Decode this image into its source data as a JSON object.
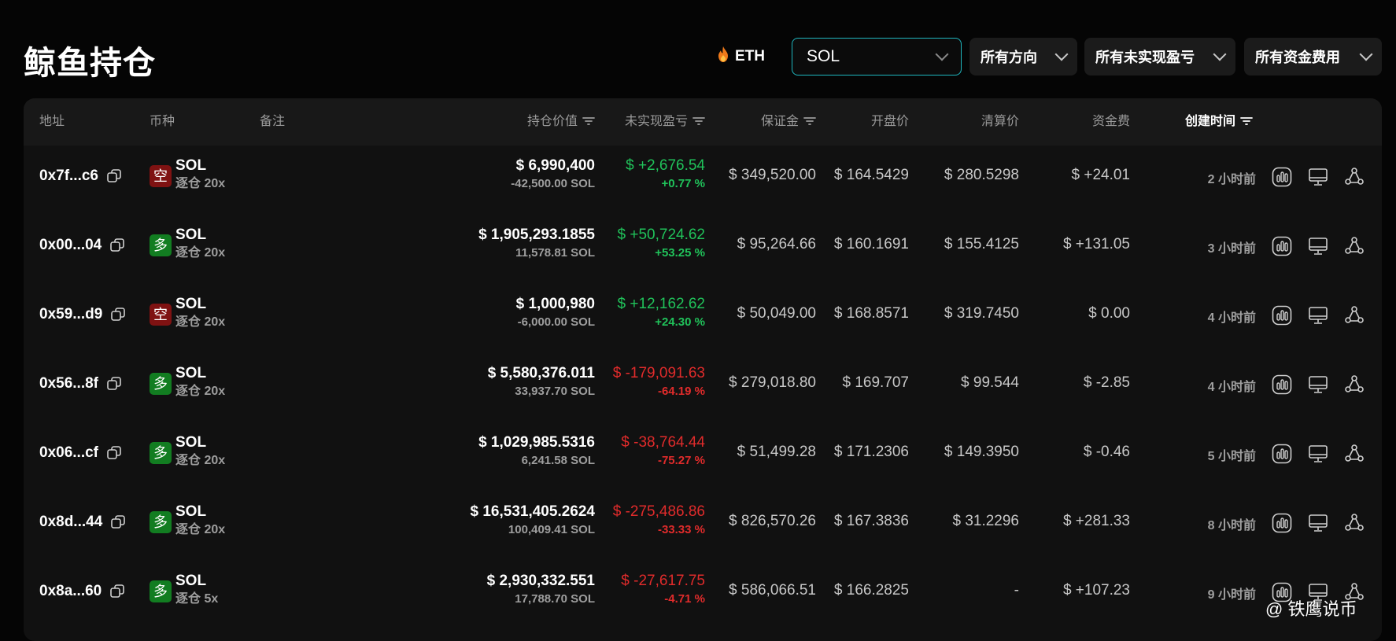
{
  "title": "鲸鱼持仓",
  "filters": {
    "eth_label": "ETH",
    "eth_icon": "fire-icon",
    "coin_select": "SOL",
    "direction_select": "所有方向",
    "pnl_select": "所有未实现盈亏",
    "funding_select": "所有资金费用"
  },
  "columns": {
    "address": "地址",
    "coin": "币种",
    "note": "备注",
    "value": "持仓价值",
    "pnl": "未实现盈亏",
    "margin": "保证金",
    "entry": "开盘价",
    "liq": "清算价",
    "funding": "资金费",
    "created": "创建时间"
  },
  "colors": {
    "positive": "#20c25a",
    "negative": "#e02b2b",
    "short_badge": "#7f1212",
    "long_badge": "#127d21",
    "accent_border": "#1fb7bf"
  },
  "rows": [
    {
      "address": "0x7f...c6",
      "side": "空",
      "side_type": "short",
      "coin": "SOL",
      "leverage": "逐仓 20x",
      "value": "$ 6,990,400",
      "amount": "-42,500.00 SOL",
      "pnl": "$ +2,676.54",
      "pnl_pct": "+0.77 %",
      "pnl_sign": "pos",
      "margin": "$ 349,520.00",
      "entry": "$ 164.5429",
      "liq": "$ 280.5298",
      "funding": "$ +24.01",
      "funding_sign": "pos",
      "created": "2 小时前"
    },
    {
      "address": "0x00...04",
      "side": "多",
      "side_type": "long",
      "coin": "SOL",
      "leverage": "逐仓 20x",
      "value": "$ 1,905,293.1855",
      "amount": "11,578.81 SOL",
      "pnl": "$ +50,724.62",
      "pnl_pct": "+53.25 %",
      "pnl_sign": "pos",
      "margin": "$ 95,264.66",
      "entry": "$ 160.1691",
      "liq": "$ 155.4125",
      "funding": "$ +131.05",
      "funding_sign": "pos",
      "created": "3 小时前"
    },
    {
      "address": "0x59...d9",
      "side": "空",
      "side_type": "short",
      "coin": "SOL",
      "leverage": "逐仓 20x",
      "value": "$ 1,000,980",
      "amount": "-6,000.00 SOL",
      "pnl": "$ +12,162.62",
      "pnl_pct": "+24.30 %",
      "pnl_sign": "pos",
      "margin": "$ 50,049.00",
      "entry": "$ 168.8571",
      "liq": "$ 319.7450",
      "funding": "$ 0.00",
      "funding_sign": "neutral",
      "created": "4 小时前"
    },
    {
      "address": "0x56...8f",
      "side": "多",
      "side_type": "long",
      "coin": "SOL",
      "leverage": "逐仓 20x",
      "value": "$ 5,580,376.011",
      "amount": "33,937.70 SOL",
      "pnl": "$ -179,091.63",
      "pnl_pct": "-64.19 %",
      "pnl_sign": "neg",
      "margin": "$ 279,018.80",
      "entry": "$ 169.707",
      "liq": "$ 99.544",
      "funding": "$ -2.85",
      "funding_sign": "neg",
      "created": "4 小时前"
    },
    {
      "address": "0x06...cf",
      "side": "多",
      "side_type": "long",
      "coin": "SOL",
      "leverage": "逐仓 20x",
      "value": "$ 1,029,985.5316",
      "amount": "6,241.58 SOL",
      "pnl": "$ -38,764.44",
      "pnl_pct": "-75.27 %",
      "pnl_sign": "neg",
      "margin": "$ 51,499.28",
      "entry": "$ 171.2306",
      "liq": "$ 149.3950",
      "funding": "$ -0.46",
      "funding_sign": "neg",
      "created": "5 小时前"
    },
    {
      "address": "0x8d...44",
      "side": "多",
      "side_type": "long",
      "coin": "SOL",
      "leverage": "逐仓 20x",
      "value": "$ 16,531,405.2624",
      "amount": "100,409.41 SOL",
      "pnl": "$ -275,486.86",
      "pnl_pct": "-33.33 %",
      "pnl_sign": "neg",
      "margin": "$ 826,570.26",
      "entry": "$ 167.3836",
      "liq": "$ 31.2296",
      "funding": "$ +281.33",
      "funding_sign": "pos",
      "created": "8 小时前"
    },
    {
      "address": "0x8a...60",
      "side": "多",
      "side_type": "long",
      "coin": "SOL",
      "leverage": "逐仓 5x",
      "value": "$ 2,930,332.551",
      "amount": "17,788.70 SOL",
      "pnl": "$ -27,617.75",
      "pnl_pct": "-4.71 %",
      "pnl_sign": "neg",
      "margin": "$ 586,066.51",
      "entry": "$ 166.2825",
      "liq": "-",
      "funding": "$ +107.23",
      "funding_sign": "pos",
      "created": "9 小时前"
    }
  ],
  "watermark": "@ 铁鹰说币"
}
